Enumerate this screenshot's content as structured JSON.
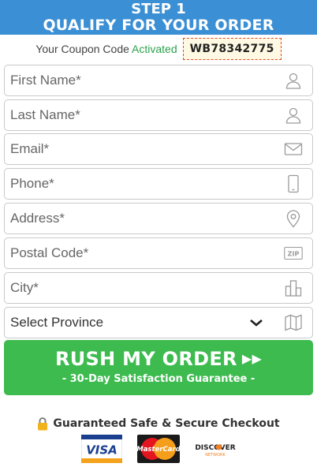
{
  "header": {
    "step": "STEP 1",
    "title": "QUALIFY FOR YOUR ORDER"
  },
  "coupon": {
    "prefix": "Your Coupon Code",
    "status": "Activated",
    "code": "WB78342775"
  },
  "form": {
    "first_name": "First Name*",
    "last_name": "Last Name*",
    "email": "Email*",
    "phone": "Phone*",
    "address": "Address*",
    "postal_code": "Postal Code*",
    "city": "City*",
    "province": "Select Province"
  },
  "cta": {
    "label": "RUSH MY ORDER",
    "arrows": "▶▶",
    "guarantee": "- 30-Day Satisfaction Guarantee -"
  },
  "secure": {
    "label": "Guaranteed Safe & Secure Checkout"
  },
  "payment": {
    "visa": "VISA",
    "mastercard": "MasterCard",
    "discover": "DISCOVER",
    "discover_sub": "NETWORK"
  },
  "icons": [
    "user-icon",
    "user-icon",
    "envelope-icon",
    "phone-icon",
    "map-pin-icon",
    "zip-icon",
    "city-icon",
    "map-icon",
    "chevron-down-icon",
    "lock-icon"
  ],
  "colors": {
    "header": "#3b8fd4",
    "cta": "#3dbb4f",
    "activated": "#2aa24b",
    "coupon_border": "#e04b1f"
  }
}
